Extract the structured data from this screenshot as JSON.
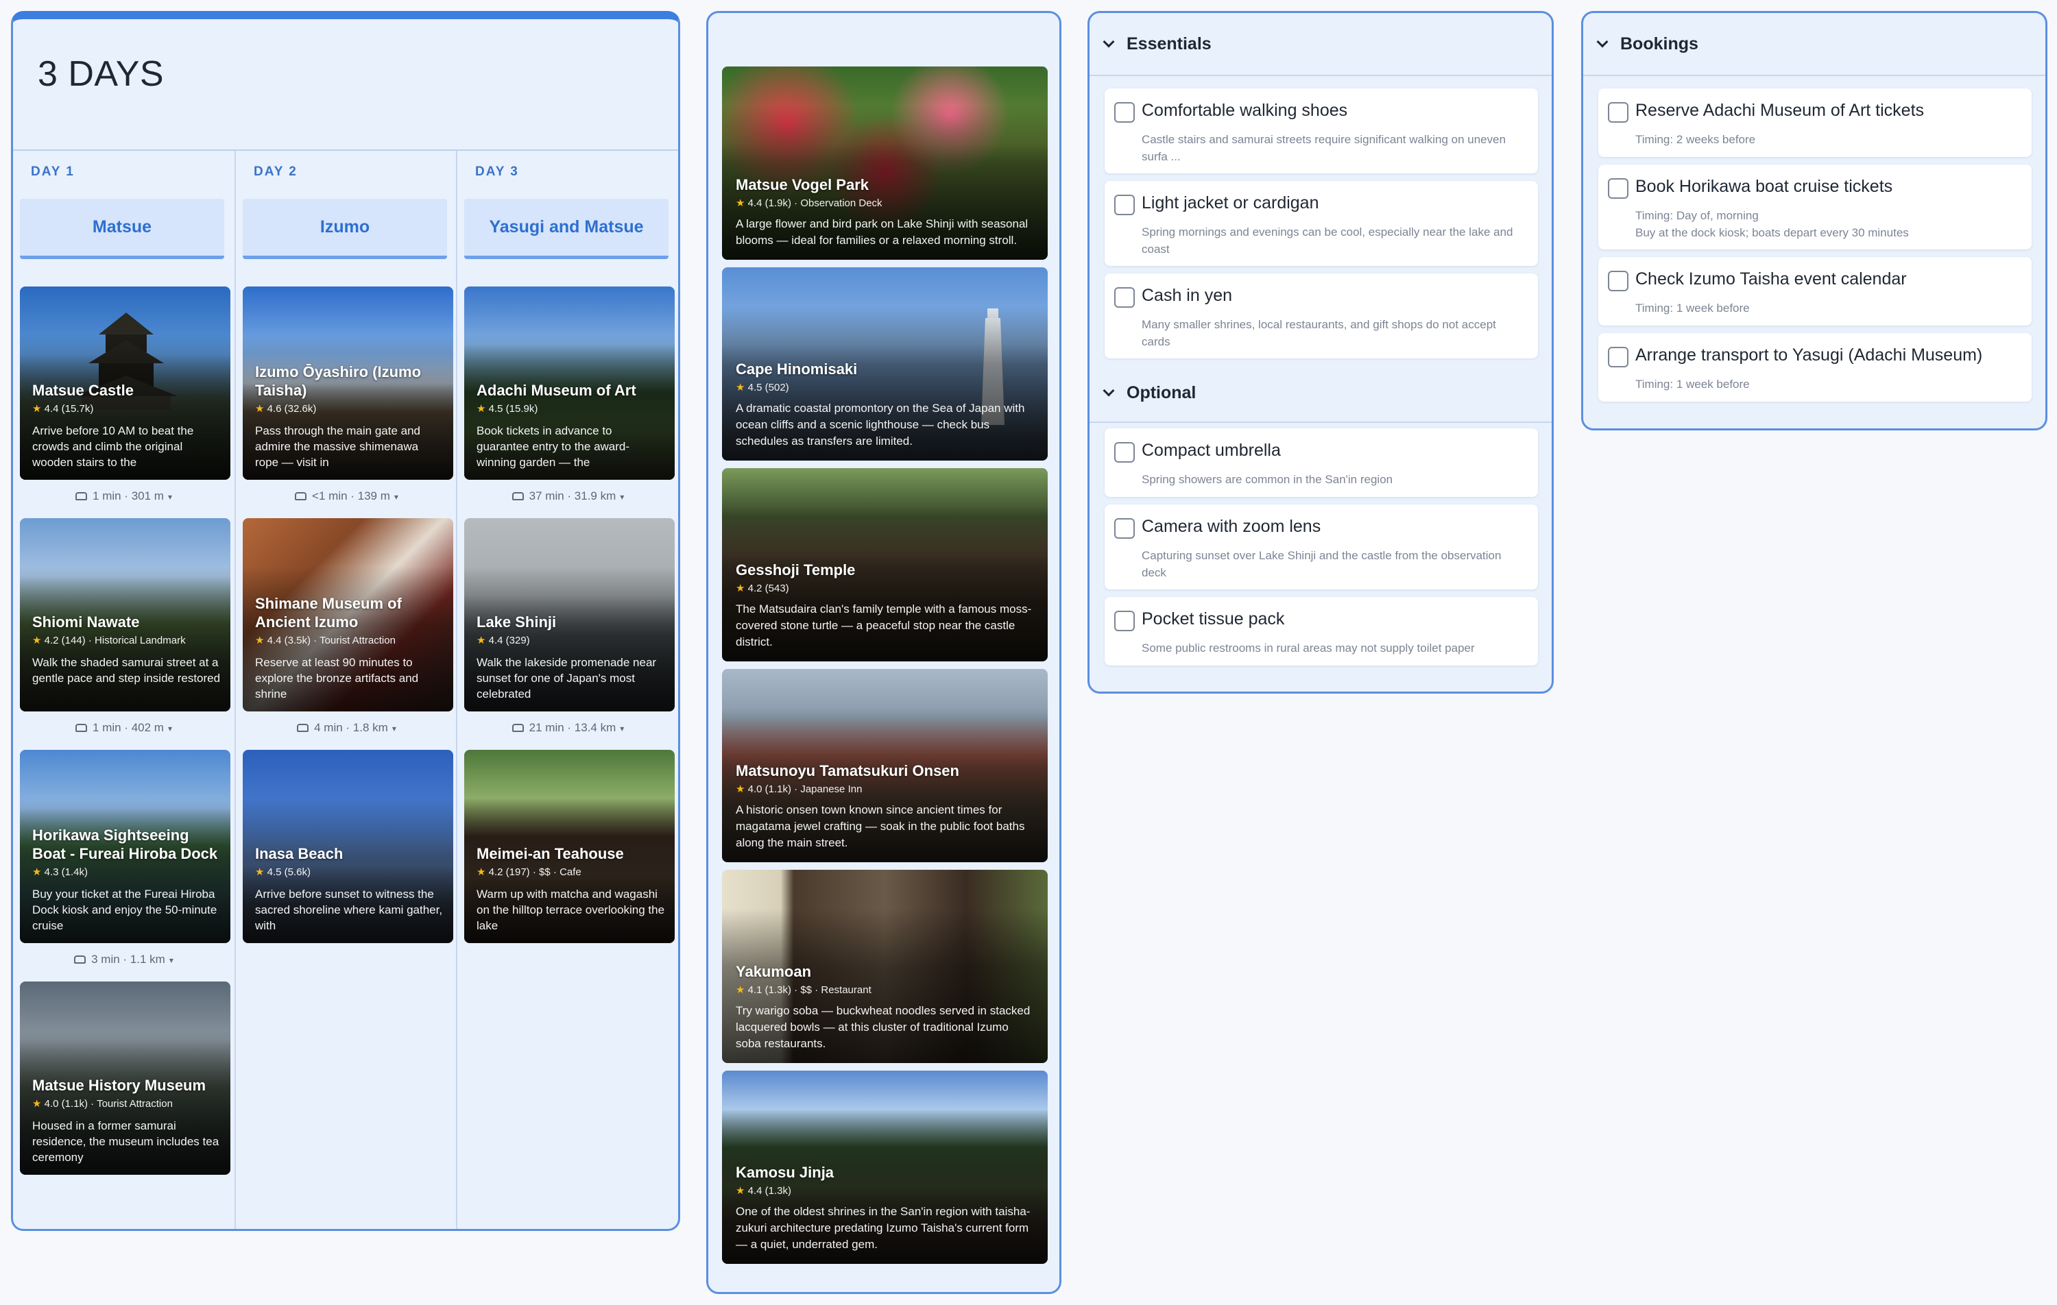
{
  "itinerary": {
    "title": "3 DAYS",
    "days": [
      {
        "label": "DAY 1",
        "city": "Matsue",
        "places": [
          {
            "name": "Matsue Castle",
            "rating": "4.4",
            "reviews": "(15.7k)",
            "category": "",
            "price": "",
            "desc": "Arrive before 10 AM to beat the crowds and climb the original wooden stairs to the",
            "image": "castle"
          },
          {
            "name": "Shiomi Nawate",
            "rating": "4.2",
            "reviews": "(144)",
            "category": "Historical Landmark",
            "price": "",
            "desc": "Walk the shaded samurai street at a gentle pace and step inside restored",
            "image": "street"
          },
          {
            "name": "Horikawa Sightseeing Boat - Fureai Hiroba Dock",
            "rating": "4.3",
            "reviews": "(1.4k)",
            "category": "",
            "price": "",
            "desc": "Buy your ticket at the Fureai Hiroba Dock kiosk and enjoy the 50-minute cruise",
            "image": "river"
          },
          {
            "name": "Matsue History Museum",
            "rating": "4.0",
            "reviews": "(1.1k)",
            "category": "Tourist Attraction",
            "price": "",
            "desc": "Housed in a former samurai residence, the museum includes tea ceremony",
            "image": "museum"
          }
        ],
        "travels": [
          "1 min · 301 m",
          "1 min · 402 m",
          "3 min · 1.1 km"
        ]
      },
      {
        "label": "DAY 2",
        "city": "Izumo",
        "places": [
          {
            "name": "Izumo Ōyashiro (Izumo Taisha)",
            "rating": "4.6",
            "reviews": "(32.6k)",
            "category": "",
            "price": "",
            "desc": "Pass through the main gate and admire the massive shimenawa rope — visit in",
            "image": "shrine"
          },
          {
            "name": "Shimane Museum of Ancient Izumo",
            "rating": "4.4",
            "reviews": "(3.5k)",
            "category": "Tourist Attraction",
            "price": "",
            "desc": "Reserve at least 90 minutes to explore the bronze artifacts and shrine",
            "image": "interior"
          },
          {
            "name": "Inasa Beach",
            "rating": "4.5",
            "reviews": "(5.6k)",
            "category": "",
            "price": "",
            "desc": "Arrive before sunset to witness the sacred shoreline where kami gather, with",
            "image": "beach"
          }
        ],
        "travels": [
          "<1 min · 139 m",
          "4 min · 1.8 km"
        ]
      },
      {
        "label": "DAY 3",
        "city": "Yasugi and Matsue",
        "places": [
          {
            "name": "Adachi Museum of Art",
            "rating": "4.5",
            "reviews": "(15.9k)",
            "category": "",
            "price": "",
            "desc": "Book tickets in advance to guarantee entry to the award-winning garden — the",
            "image": "garden"
          },
          {
            "name": "Lake Shinji",
            "rating": "4.4",
            "reviews": "(329)",
            "category": "",
            "price": "",
            "desc": "Walk the lakeside promenade near sunset for one of Japan's most celebrated",
            "image": "lake"
          },
          {
            "name": "Meimei-an Teahouse",
            "rating": "4.2",
            "reviews": "(197)",
            "category": "Cafe",
            "price": "$$",
            "desc": "Warm up with matcha and wagashi on the hilltop terrace overlooking the lake",
            "image": "teahouse"
          }
        ],
        "travels": [
          "37 min · 31.9 km",
          "21 min · 13.4 km"
        ]
      }
    ]
  },
  "explore": {
    "cards": [
      {
        "name": "Matsue Vogel Park",
        "rating": "4.4",
        "reviews": "(1.9k)",
        "category": "Observation Deck",
        "price": "",
        "desc": "A large flower and bird park on Lake Shinji with seasonal blooms — ideal for families or a relaxed morning stroll.",
        "image": "flowers"
      },
      {
        "name": "Cape Hinomisaki",
        "rating": "4.5",
        "reviews": "(502)",
        "category": "",
        "price": "",
        "desc": "A dramatic coastal promontory on the Sea of Japan with ocean cliffs and a scenic lighthouse — check bus schedules as transfers are limited.",
        "image": "lighthouse"
      },
      {
        "name": "Gesshoji Temple",
        "rating": "4.2",
        "reviews": "(543)",
        "category": "",
        "price": "",
        "desc": "The Matsudaira clan's family temple with a famous moss-covered stone turtle — a peaceful stop near the castle district.",
        "image": "temple"
      },
      {
        "name": "Matsunoyu Tamatsukuri Onsen",
        "rating": "4.0",
        "reviews": "(1.1k)",
        "category": "Japanese Inn",
        "price": "",
        "desc": "A historic onsen town known since ancient times for magatama jewel crafting — soak in the public foot baths along the main street.",
        "image": "onsen"
      },
      {
        "name": "Yakumoan",
        "rating": "4.1",
        "reviews": "(1.3k)",
        "category": "Restaurant",
        "price": "$$",
        "desc": "Try warigo soba — buckwheat noodles served in stacked lacquered bowls — at this cluster of traditional Izumo soba restaurants.",
        "image": "soba"
      },
      {
        "name": "Kamosu Jinja",
        "rating": "4.4",
        "reviews": "(1.3k)",
        "category": "",
        "price": "",
        "desc": "One of the oldest shrines in the San'in region with taisha-zukuri architecture predating Izumo Taisha's current form — a quiet, underrated gem.",
        "image": "forest"
      }
    ]
  },
  "packing": {
    "sections": [
      {
        "title": "Essentials",
        "items": [
          {
            "title": "Comfortable walking shoes",
            "note": "Castle stairs and samurai streets require significant walking on uneven surfa ..."
          },
          {
            "title": "Light jacket or cardigan",
            "note": "Spring mornings and evenings can be cool, especially near the lake and coast"
          },
          {
            "title": "Cash in yen",
            "note": "Many smaller shrines, local restaurants, and gift shops do not accept cards"
          }
        ]
      },
      {
        "title": "Optional",
        "items": [
          {
            "title": "Compact umbrella",
            "note": "Spring showers are common in the San'in region"
          },
          {
            "title": "Camera with zoom lens",
            "note": "Capturing sunset over Lake Shinji and the castle from the observation deck"
          },
          {
            "title": "Pocket tissue pack",
            "note": "Some public restrooms in rural areas may not supply toilet paper"
          }
        ]
      }
    ]
  },
  "bookings": {
    "title": "Bookings",
    "items": [
      {
        "title": "Reserve Adachi Museum of Art tickets",
        "note": "Timing: 2 weeks before"
      },
      {
        "title": "Book Horikawa boat cruise tickets",
        "note": "Timing: Day of, morning",
        "note2": "Buy at the dock kiosk; boats depart every 30 minutes"
      },
      {
        "title": "Check Izumo Taisha event calendar",
        "note": "Timing: 1 week before"
      },
      {
        "title": "Arrange transport to Yasugi (Adachi Museum)",
        "note": "Timing: 1 week before"
      }
    ]
  },
  "colors": {
    "accent": "#3d7de0",
    "panel_bg": "#e9f1fd",
    "star": "#f6b91a"
  }
}
